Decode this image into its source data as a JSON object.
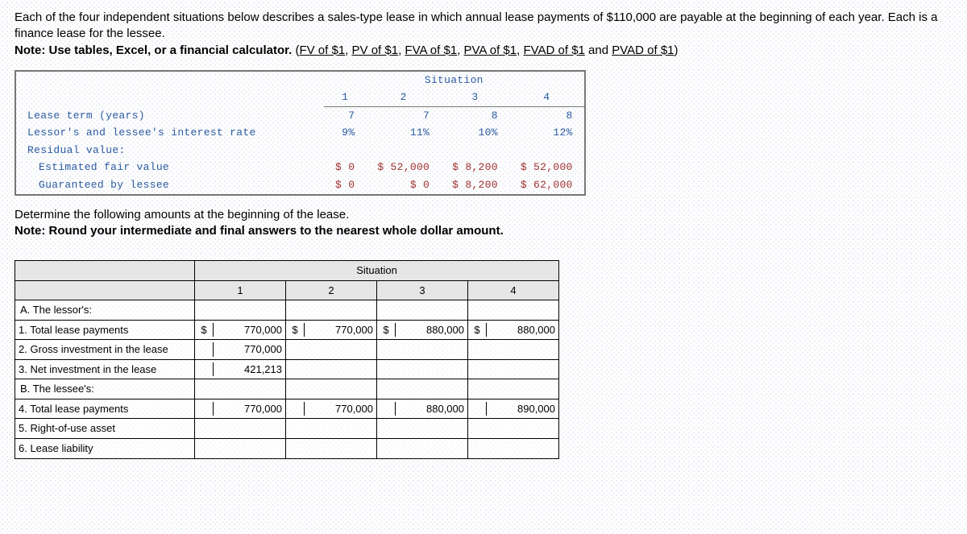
{
  "intro": {
    "line1": "Each of the four independent situations below describes a sales-type lease in which annual lease payments of $110,000 are payable at the beginning of each year. Each is a finance lease for the lessee.",
    "note_label": "Note: Use tables, Excel, or a financial calculator.",
    "links": {
      "l1": "FV of $1",
      "l2": "PV of $1",
      "l3": "FVA of $1",
      "l4": "PVA of $1",
      "l5": "FVAD of $1",
      "l6": "PVAD of $1"
    }
  },
  "given": {
    "title": "Situation",
    "cols": [
      "1",
      "2",
      "3",
      "4"
    ],
    "rows": {
      "term": {
        "label": "Lease term (years)",
        "v": [
          "7",
          "7",
          "8",
          "8"
        ]
      },
      "rate": {
        "label": "Lessor's and lessee's interest rate",
        "v": [
          "9%",
          "11%",
          "10%",
          "12%"
        ]
      },
      "resid": {
        "label": "Residual value:",
        "v": [
          "",
          "",
          "",
          ""
        ]
      },
      "efv": {
        "label": "  Estimated fair value",
        "v": [
          "$ 0",
          "$ 52,000",
          "$ 8,200",
          "$ 52,000"
        ]
      },
      "gbl": {
        "label": "  Guaranteed by lessee",
        "v": [
          "$ 0",
          "$ 0",
          "$ 8,200",
          "$ 62,000"
        ]
      }
    }
  },
  "mid": {
    "line1": "Determine the following amounts at the beginning of the lease.",
    "line2": "Note: Round your intermediate and final answers to the nearest whole dollar amount."
  },
  "answer": {
    "title": "Situation",
    "cols": [
      "1",
      "2",
      "3",
      "4"
    ],
    "sectionA": "A. The lessor's:",
    "sectionB": "B. The lessee's:",
    "rows": {
      "a1": {
        "label": "1. Total lease payments",
        "cur": [
          "$",
          "$",
          "$",
          "$"
        ],
        "v": [
          "770,000",
          "770,000",
          "880,000",
          "880,000"
        ]
      },
      "a2": {
        "label": "2. Gross investment in the lease",
        "cur": [
          "",
          "",
          "",
          ""
        ],
        "v": [
          "770,000",
          "",
          "",
          ""
        ]
      },
      "a3": {
        "label": "3. Net investment in the lease",
        "cur": [
          "",
          "",
          "",
          ""
        ],
        "v": [
          "421,213",
          "",
          "",
          ""
        ]
      },
      "b4": {
        "label": "4. Total lease payments",
        "cur": [
          "",
          "",
          "",
          ""
        ],
        "v": [
          "770,000",
          "770,000",
          "880,000",
          "890,000"
        ]
      },
      "b5": {
        "label": "5. Right-of-use asset",
        "cur": [
          "",
          "",
          "",
          ""
        ],
        "v": [
          "",
          "",
          "",
          ""
        ]
      },
      "b6": {
        "label": "6. Lease liability",
        "cur": [
          "",
          "",
          "",
          ""
        ],
        "v": [
          "",
          "",
          "",
          ""
        ]
      }
    }
  }
}
